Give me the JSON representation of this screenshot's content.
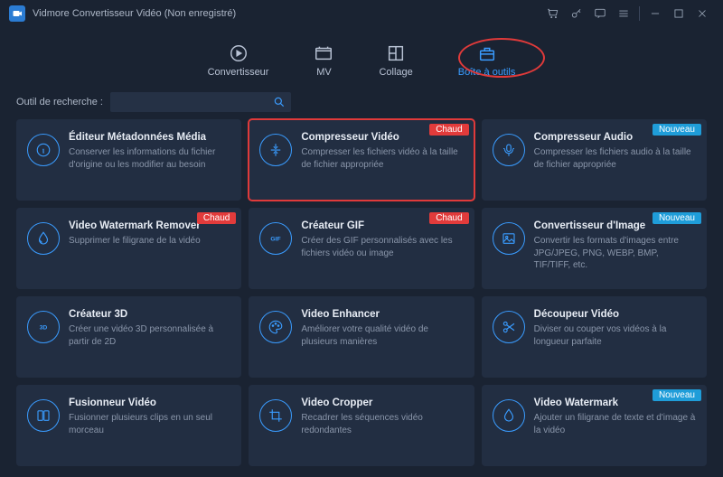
{
  "app": {
    "title": "Vidmore Convertisseur Vidéo (Non enregistré)"
  },
  "nav": {
    "items": [
      {
        "label": "Convertisseur"
      },
      {
        "label": "MV"
      },
      {
        "label": "Collage"
      },
      {
        "label": "Boîte à outils"
      }
    ]
  },
  "search": {
    "label": "Outil de recherche :",
    "value": ""
  },
  "badges": {
    "hot": "Chaud",
    "new": "Nouveau"
  },
  "tools": [
    {
      "title": "Éditeur Métadonnées Média",
      "desc": "Conserver les informations du fichier d'origine ou les modifier au besoin",
      "badge": null,
      "icon": "info"
    },
    {
      "title": "Compresseur Vidéo",
      "desc": "Compresser les fichiers vidéo à la taille de fichier appropriée",
      "badge": "hot",
      "icon": "compress",
      "selected": true
    },
    {
      "title": "Compresseur Audio",
      "desc": "Compresser les fichiers audio à la taille de fichier appropriée",
      "badge": "new",
      "icon": "audio"
    },
    {
      "title": "Video Watermark Remover",
      "desc": "Supprimer le filigrane de la vidéo",
      "badge": "hot",
      "icon": "drop"
    },
    {
      "title": "Créateur GIF",
      "desc": "Créer des GIF personnalisés avec les fichiers vidéo ou image",
      "badge": "hot",
      "icon": "gif"
    },
    {
      "title": "Convertisseur d'Image",
      "desc": "Convertir les formats d'images entre JPG/JPEG, PNG, WEBP, BMP, TIF/TIFF, etc.",
      "badge": "new",
      "icon": "image"
    },
    {
      "title": "Créateur 3D",
      "desc": "Créer une vidéo 3D personnalisée à partir de 2D",
      "badge": null,
      "icon": "3d"
    },
    {
      "title": "Video Enhancer",
      "desc": "Améliorer votre qualité vidéo de plusieurs manières",
      "badge": null,
      "icon": "palette"
    },
    {
      "title": "Découpeur Vidéo",
      "desc": "Diviser ou couper vos vidéos à la longueur parfaite",
      "badge": null,
      "icon": "scissors"
    },
    {
      "title": "Fusionneur Vidéo",
      "desc": "Fusionner plusieurs clips en un seul morceau",
      "badge": null,
      "icon": "merge"
    },
    {
      "title": "Video Cropper",
      "desc": "Recadrer les séquences vidéo redondantes",
      "badge": null,
      "icon": "crop"
    },
    {
      "title": "Video Watermark",
      "desc": "Ajouter un filigrane de texte et d'image à la vidéo",
      "badge": "new",
      "icon": "watermark"
    }
  ]
}
